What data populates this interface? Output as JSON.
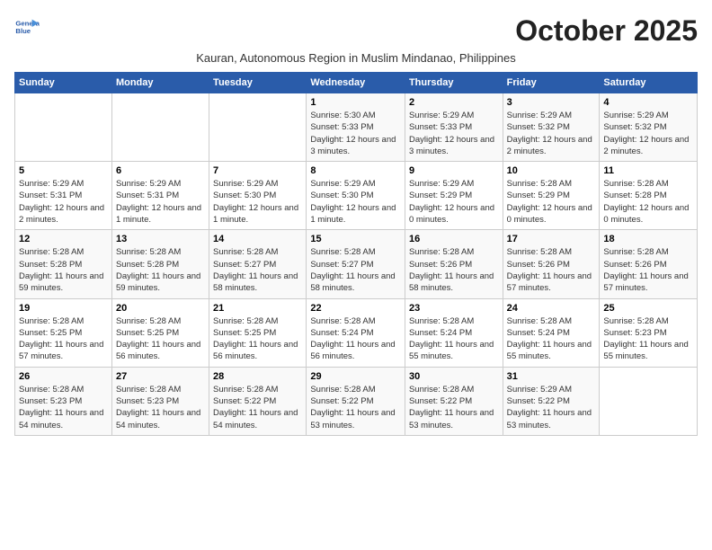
{
  "logo": {
    "line1": "General",
    "line2": "Blue"
  },
  "title": "October 2025",
  "subtitle": "Kauran, Autonomous Region in Muslim Mindanao, Philippines",
  "days_of_week": [
    "Sunday",
    "Monday",
    "Tuesday",
    "Wednesday",
    "Thursday",
    "Friday",
    "Saturday"
  ],
  "weeks": [
    [
      {
        "day": "",
        "sunrise": "",
        "sunset": "",
        "daylight": ""
      },
      {
        "day": "",
        "sunrise": "",
        "sunset": "",
        "daylight": ""
      },
      {
        "day": "",
        "sunrise": "",
        "sunset": "",
        "daylight": ""
      },
      {
        "day": "1",
        "sunrise": "Sunrise: 5:30 AM",
        "sunset": "Sunset: 5:33 PM",
        "daylight": "Daylight: 12 hours and 3 minutes."
      },
      {
        "day": "2",
        "sunrise": "Sunrise: 5:29 AM",
        "sunset": "Sunset: 5:33 PM",
        "daylight": "Daylight: 12 hours and 3 minutes."
      },
      {
        "day": "3",
        "sunrise": "Sunrise: 5:29 AM",
        "sunset": "Sunset: 5:32 PM",
        "daylight": "Daylight: 12 hours and 2 minutes."
      },
      {
        "day": "4",
        "sunrise": "Sunrise: 5:29 AM",
        "sunset": "Sunset: 5:32 PM",
        "daylight": "Daylight: 12 hours and 2 minutes."
      }
    ],
    [
      {
        "day": "5",
        "sunrise": "Sunrise: 5:29 AM",
        "sunset": "Sunset: 5:31 PM",
        "daylight": "Daylight: 12 hours and 2 minutes."
      },
      {
        "day": "6",
        "sunrise": "Sunrise: 5:29 AM",
        "sunset": "Sunset: 5:31 PM",
        "daylight": "Daylight: 12 hours and 1 minute."
      },
      {
        "day": "7",
        "sunrise": "Sunrise: 5:29 AM",
        "sunset": "Sunset: 5:30 PM",
        "daylight": "Daylight: 12 hours and 1 minute."
      },
      {
        "day": "8",
        "sunrise": "Sunrise: 5:29 AM",
        "sunset": "Sunset: 5:30 PM",
        "daylight": "Daylight: 12 hours and 1 minute."
      },
      {
        "day": "9",
        "sunrise": "Sunrise: 5:29 AM",
        "sunset": "Sunset: 5:29 PM",
        "daylight": "Daylight: 12 hours and 0 minutes."
      },
      {
        "day": "10",
        "sunrise": "Sunrise: 5:28 AM",
        "sunset": "Sunset: 5:29 PM",
        "daylight": "Daylight: 12 hours and 0 minutes."
      },
      {
        "day": "11",
        "sunrise": "Sunrise: 5:28 AM",
        "sunset": "Sunset: 5:28 PM",
        "daylight": "Daylight: 12 hours and 0 minutes."
      }
    ],
    [
      {
        "day": "12",
        "sunrise": "Sunrise: 5:28 AM",
        "sunset": "Sunset: 5:28 PM",
        "daylight": "Daylight: 11 hours and 59 minutes."
      },
      {
        "day": "13",
        "sunrise": "Sunrise: 5:28 AM",
        "sunset": "Sunset: 5:28 PM",
        "daylight": "Daylight: 11 hours and 59 minutes."
      },
      {
        "day": "14",
        "sunrise": "Sunrise: 5:28 AM",
        "sunset": "Sunset: 5:27 PM",
        "daylight": "Daylight: 11 hours and 58 minutes."
      },
      {
        "day": "15",
        "sunrise": "Sunrise: 5:28 AM",
        "sunset": "Sunset: 5:27 PM",
        "daylight": "Daylight: 11 hours and 58 minutes."
      },
      {
        "day": "16",
        "sunrise": "Sunrise: 5:28 AM",
        "sunset": "Sunset: 5:26 PM",
        "daylight": "Daylight: 11 hours and 58 minutes."
      },
      {
        "day": "17",
        "sunrise": "Sunrise: 5:28 AM",
        "sunset": "Sunset: 5:26 PM",
        "daylight": "Daylight: 11 hours and 57 minutes."
      },
      {
        "day": "18",
        "sunrise": "Sunrise: 5:28 AM",
        "sunset": "Sunset: 5:26 PM",
        "daylight": "Daylight: 11 hours and 57 minutes."
      }
    ],
    [
      {
        "day": "19",
        "sunrise": "Sunrise: 5:28 AM",
        "sunset": "Sunset: 5:25 PM",
        "daylight": "Daylight: 11 hours and 57 minutes."
      },
      {
        "day": "20",
        "sunrise": "Sunrise: 5:28 AM",
        "sunset": "Sunset: 5:25 PM",
        "daylight": "Daylight: 11 hours and 56 minutes."
      },
      {
        "day": "21",
        "sunrise": "Sunrise: 5:28 AM",
        "sunset": "Sunset: 5:25 PM",
        "daylight": "Daylight: 11 hours and 56 minutes."
      },
      {
        "day": "22",
        "sunrise": "Sunrise: 5:28 AM",
        "sunset": "Sunset: 5:24 PM",
        "daylight": "Daylight: 11 hours and 56 minutes."
      },
      {
        "day": "23",
        "sunrise": "Sunrise: 5:28 AM",
        "sunset": "Sunset: 5:24 PM",
        "daylight": "Daylight: 11 hours and 55 minutes."
      },
      {
        "day": "24",
        "sunrise": "Sunrise: 5:28 AM",
        "sunset": "Sunset: 5:24 PM",
        "daylight": "Daylight: 11 hours and 55 minutes."
      },
      {
        "day": "25",
        "sunrise": "Sunrise: 5:28 AM",
        "sunset": "Sunset: 5:23 PM",
        "daylight": "Daylight: 11 hours and 55 minutes."
      }
    ],
    [
      {
        "day": "26",
        "sunrise": "Sunrise: 5:28 AM",
        "sunset": "Sunset: 5:23 PM",
        "daylight": "Daylight: 11 hours and 54 minutes."
      },
      {
        "day": "27",
        "sunrise": "Sunrise: 5:28 AM",
        "sunset": "Sunset: 5:23 PM",
        "daylight": "Daylight: 11 hours and 54 minutes."
      },
      {
        "day": "28",
        "sunrise": "Sunrise: 5:28 AM",
        "sunset": "Sunset: 5:22 PM",
        "daylight": "Daylight: 11 hours and 54 minutes."
      },
      {
        "day": "29",
        "sunrise": "Sunrise: 5:28 AM",
        "sunset": "Sunset: 5:22 PM",
        "daylight": "Daylight: 11 hours and 53 minutes."
      },
      {
        "day": "30",
        "sunrise": "Sunrise: 5:28 AM",
        "sunset": "Sunset: 5:22 PM",
        "daylight": "Daylight: 11 hours and 53 minutes."
      },
      {
        "day": "31",
        "sunrise": "Sunrise: 5:29 AM",
        "sunset": "Sunset: 5:22 PM",
        "daylight": "Daylight: 11 hours and 53 minutes."
      },
      {
        "day": "",
        "sunrise": "",
        "sunset": "",
        "daylight": ""
      }
    ]
  ]
}
